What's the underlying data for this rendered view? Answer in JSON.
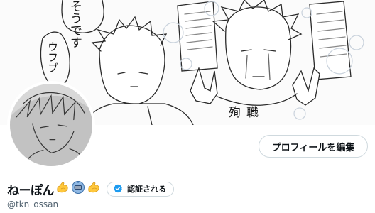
{
  "banner": {
    "speech_top": "そうです",
    "speech_left": "ウフブ",
    "caption": "殉職"
  },
  "profile": {
    "display_name": "ねーぽん",
    "emoji": [
      "flexed-biceps",
      "astronaut",
      "flexed-biceps"
    ],
    "handle": "@tkn_ossan"
  },
  "actions": {
    "edit_profile_label": "プロフィールを編集",
    "verify_label": "認証される"
  },
  "colors": {
    "verify_badge": "#1d9bf0",
    "emoji_yellow": "#ffc83d",
    "handle_gray": "#536471",
    "border": "#cfd9de"
  }
}
